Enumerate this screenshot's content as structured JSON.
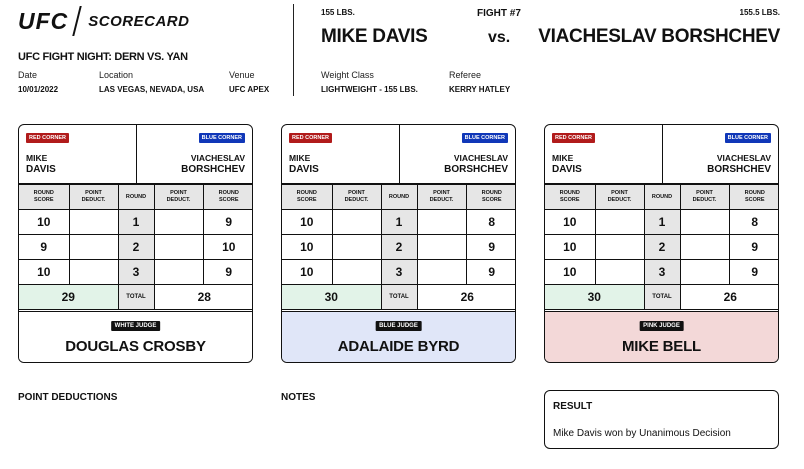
{
  "header": {
    "logo": "UFC",
    "doc_title": "SCORECARD",
    "event": "UFC FIGHT NIGHT: DERN VS. YAN",
    "date_label": "Date",
    "date": "10/01/2022",
    "location_label": "Location",
    "location": "LAS VEGAS, NEVADA, USA",
    "venue_label": "Venue",
    "venue": "UFC APEX"
  },
  "bout": {
    "red_weight": "155 LBS.",
    "fight_number": "FIGHT #7",
    "blue_weight": "155.5 LBS.",
    "red_name": "MIKE DAVIS",
    "vs": "vs.",
    "blue_name": "VIACHESLAV BORSHCHEV",
    "weight_class_label": "Weight Class",
    "weight_class": "LIGHTWEIGHT - 155 LBS.",
    "referee_label": "Referee",
    "referee": "KERRY HATLEY"
  },
  "card_labels": {
    "red_corner": "RED CORNER",
    "blue_corner": "BLUE CORNER",
    "red_first": "MIKE",
    "red_last": "DAVIS",
    "blue_first": "VIACHESLAV",
    "blue_last": "BORSHCHEV",
    "col_round_score_1": "ROUND",
    "col_round_score_2": "SCORE",
    "col_point_deduct_1": "POINT",
    "col_point_deduct_2": "DEDUCT.",
    "col_round": "ROUND",
    "total": "TOTAL"
  },
  "cards": [
    {
      "judge_tag": "WHITE JUDGE",
      "judge_name": "DOUGLAS CROSBY",
      "judge_color": "#ffffff",
      "rounds": [
        {
          "red": "10",
          "round": "1",
          "blue": "9"
        },
        {
          "red": "9",
          "round": "2",
          "blue": "10"
        },
        {
          "red": "10",
          "round": "3",
          "blue": "9"
        }
      ],
      "red_total": "29",
      "blue_total": "28"
    },
    {
      "judge_tag": "BLUE JUDGE",
      "judge_name": "ADALAIDE BYRD",
      "judge_color": "#e0e6f8",
      "rounds": [
        {
          "red": "10",
          "round": "1",
          "blue": "8"
        },
        {
          "red": "10",
          "round": "2",
          "blue": "9"
        },
        {
          "red": "10",
          "round": "3",
          "blue": "9"
        }
      ],
      "red_total": "30",
      "blue_total": "26"
    },
    {
      "judge_tag": "PINK JUDGE",
      "judge_name": "MIKE BELL",
      "judge_color": "#f3d8d8",
      "rounds": [
        {
          "red": "10",
          "round": "1",
          "blue": "8"
        },
        {
          "red": "10",
          "round": "2",
          "blue": "9"
        },
        {
          "red": "10",
          "round": "3",
          "blue": "9"
        }
      ],
      "red_total": "30",
      "blue_total": "26"
    }
  ],
  "footer": {
    "point_deductions": "POINT DEDUCTIONS",
    "notes": "NOTES",
    "result_title": "RESULT",
    "result_text": "Mike Davis won by Unanimous Decision"
  }
}
